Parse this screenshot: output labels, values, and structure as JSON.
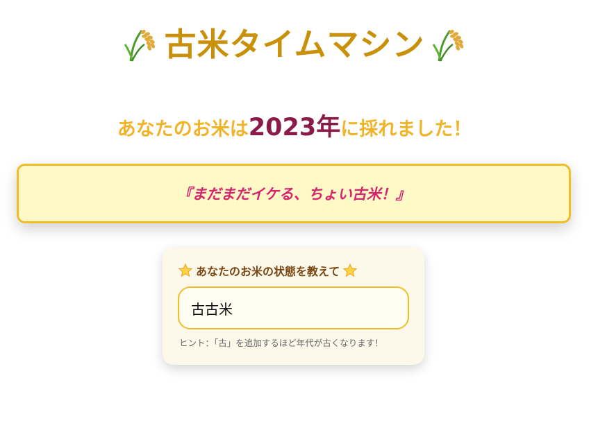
{
  "header": {
    "title": "古米タイムマシン",
    "left_icon": "rice-plant-icon",
    "right_icon": "rice-plant-icon"
  },
  "result": {
    "prefix": "あなたのお米は",
    "year": "2023年",
    "suffix": "に採れました！"
  },
  "message": {
    "text": "『まだまだイケる、ちょい古米！』"
  },
  "form": {
    "label": "あなたのお米の状態を教えて",
    "label_icon": "star-icon",
    "input_value": "古古米",
    "hint": "ヒント：「古」を追加するほど年代が古くなります！"
  },
  "colors": {
    "title": "#c9900a",
    "accent_yellow": "#f0b429",
    "year": "#8a1a48",
    "message": "#d6246e",
    "box_border": "#f0bd29",
    "box_bg": "#fff9c7"
  }
}
